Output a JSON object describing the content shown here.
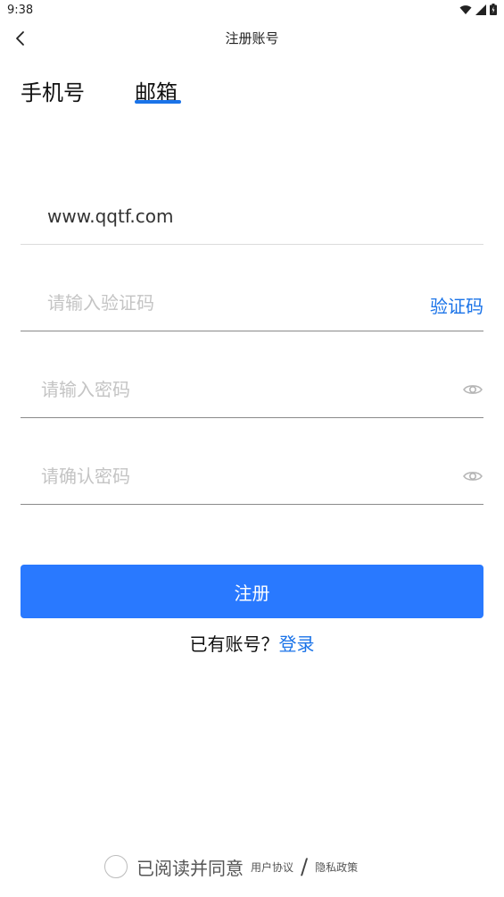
{
  "status_bar": {
    "time": "9:38"
  },
  "header": {
    "title": "注册账号",
    "back_icon": "chevron-left-icon"
  },
  "tabs": [
    {
      "label": "手机号",
      "active": false
    },
    {
      "label": "邮箱",
      "active": true
    }
  ],
  "form": {
    "email": {
      "value": "www.qqtf.com"
    },
    "code": {
      "placeholder": "请输入验证码",
      "button_label": "验证码"
    },
    "password": {
      "placeholder": "请输入密码"
    },
    "confirm_password": {
      "placeholder": "请确认密码"
    }
  },
  "register_label": "注册",
  "login_prompt": {
    "text": "已有账号？",
    "link": "登录"
  },
  "agreement": {
    "text": "已阅读并同意",
    "user_agreement": "用户协议",
    "separator": "/",
    "privacy_policy": "隐私政策"
  },
  "colors": {
    "accent": "#2979ff",
    "link": "#1a73e8",
    "placeholder": "#c4c4c4"
  }
}
